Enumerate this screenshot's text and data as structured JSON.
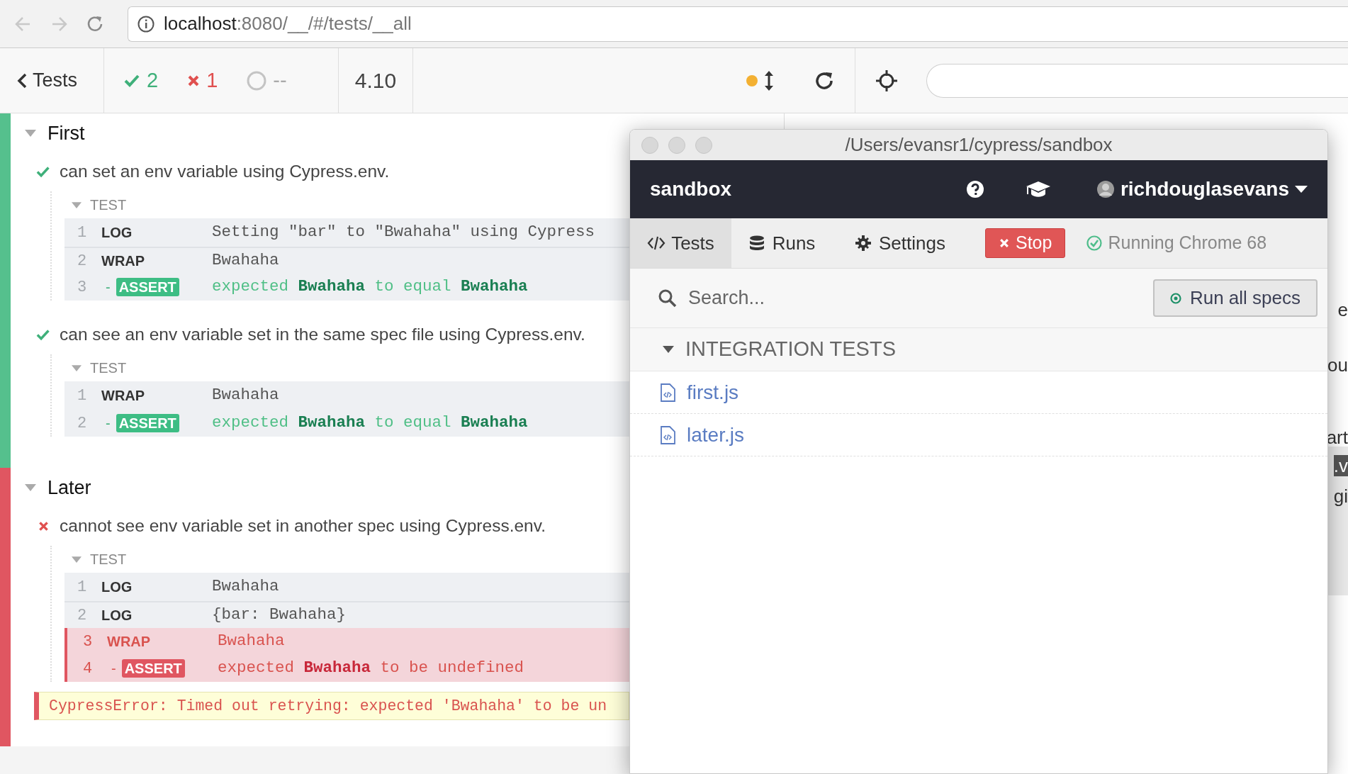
{
  "browser": {
    "url_host": "localhost",
    "url_rest": ":8080/__/#/tests/__all"
  },
  "reporter": {
    "back_label": "Tests",
    "passed": "2",
    "failed": "1",
    "pending": "--",
    "duration": "4.10"
  },
  "suites": [
    {
      "title": "First",
      "failed": false,
      "tests": [
        {
          "title": "can set an env variable using Cypress.env.",
          "failed": false,
          "hook": "TEST",
          "commands": [
            {
              "number": "1",
              "kind": "command",
              "name": "LOG",
              "message": "Setting \"bar\" to \"Bwahaha\" using Cypress",
              "failed": false
            },
            {
              "number": "2",
              "kind": "command",
              "name": "WRAP",
              "message": "Bwahaha",
              "failed": false
            },
            {
              "number": "3",
              "kind": "assert",
              "marker": "-",
              "name": "ASSERT",
              "message": "expected **Bwahaha** to equal **Bwahaha**",
              "failed": false
            }
          ]
        },
        {
          "title": "can see an env variable set in the same spec file using Cypress.env.",
          "failed": false,
          "hook": "TEST",
          "commands": [
            {
              "number": "1",
              "kind": "command",
              "name": "WRAP",
              "message": "Bwahaha",
              "failed": false
            },
            {
              "number": "2",
              "kind": "assert",
              "marker": "-",
              "name": "ASSERT",
              "message": "expected **Bwahaha** to equal **Bwahaha**",
              "failed": false
            }
          ]
        }
      ]
    },
    {
      "title": "Later",
      "failed": true,
      "tests": [
        {
          "title": "cannot see env variable set in another spec using Cypress.env.",
          "failed": true,
          "hook": "TEST",
          "commands": [
            {
              "number": "1",
              "kind": "command",
              "name": "LOG",
              "message": "Bwahaha",
              "failed": false
            },
            {
              "number": "2",
              "kind": "command",
              "name": "LOG",
              "message": "{bar: Bwahaha}",
              "failed": false
            },
            {
              "number": "3",
              "kind": "command",
              "name": "WRAP",
              "message": "Bwahaha",
              "failed": true
            },
            {
              "number": "4",
              "kind": "assert",
              "marker": "-",
              "name": "ASSERT",
              "message": "expected **Bwahaha** to be undefined",
              "failed": true
            }
          ],
          "error": "CypressError: Timed out retrying: expected 'Bwahaha' to be un"
        }
      ]
    }
  ],
  "background_fragments": [
    "e",
    "ou",
    "art",
    ".v",
    "gi"
  ],
  "window": {
    "title": "/Users/evansr1/cypress/sandbox",
    "project": "sandbox",
    "user": "richdouglasevans",
    "tabs": [
      {
        "label": "Tests",
        "selected": true
      },
      {
        "label": "Runs",
        "selected": false
      },
      {
        "label": "Settings",
        "selected": false
      }
    ],
    "stop_label": "Stop",
    "status": "Running Chrome 68",
    "search": {
      "placeholder": "Search..."
    },
    "run_all_label": "Run all specs",
    "group": {
      "title": "INTEGRATION TESTS",
      "expanded": true
    },
    "files": [
      "first.js",
      "later.js"
    ]
  }
}
